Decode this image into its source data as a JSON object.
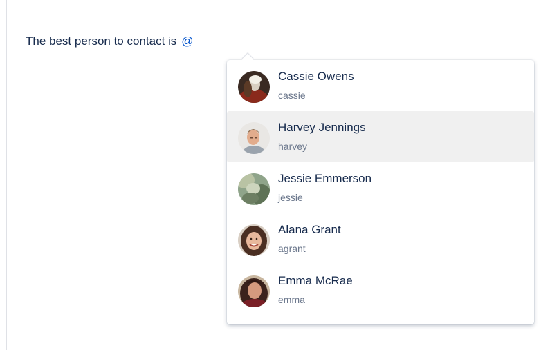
{
  "editor": {
    "text": "The best person to contact is",
    "mention_query": "@"
  },
  "colors": {
    "mention": "#0052cc",
    "text": "#172b4d",
    "secondary_text": "#6b778c",
    "highlight": "#f0f0f0"
  },
  "mention_dropdown": {
    "selected_index": 1,
    "users": [
      {
        "name": "Cassie Owens",
        "username": "cassie",
        "avatar_icon": "user-photo-cassie"
      },
      {
        "name": "Harvey Jennings",
        "username": "harvey",
        "avatar_icon": "user-photo-harvey"
      },
      {
        "name": "Jessie Emmerson",
        "username": "jessie",
        "avatar_icon": "user-photo-jessie"
      },
      {
        "name": "Alana Grant",
        "username": "agrant",
        "avatar_icon": "user-photo-alana"
      },
      {
        "name": "Emma McRae",
        "username": "emma",
        "avatar_icon": "user-photo-emma"
      }
    ]
  }
}
